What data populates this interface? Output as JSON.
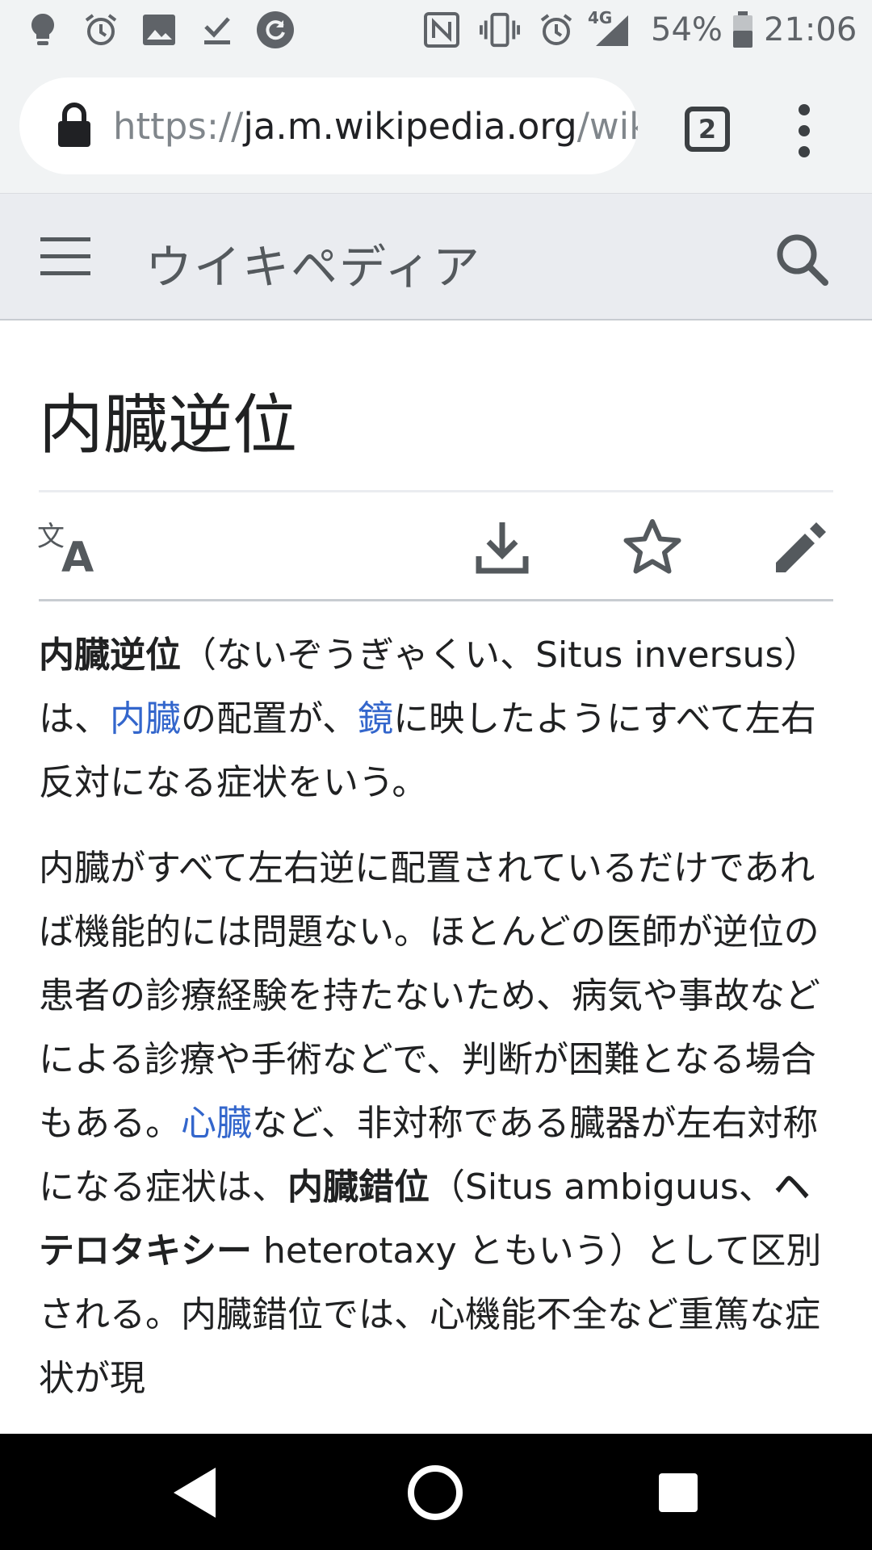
{
  "status_bar": {
    "left_icons": [
      "lightbulb-icon",
      "alarm-icon",
      "image-icon",
      "download-done-icon",
      "sync-icon"
    ],
    "right_icons": [
      "nfc-icon",
      "vibrate-icon",
      "alarm-icon",
      "signal-icon",
      "battery-icon"
    ],
    "network": "4G",
    "battery": "54%",
    "time": "21:06"
  },
  "browser": {
    "url_scheme": "https://",
    "url_host": "ja.m.wikipedia.org",
    "url_path": "/wik",
    "tab_count": "2"
  },
  "wiki_header": {
    "title": "ウイキペディア"
  },
  "page": {
    "title": "内臓逆位",
    "actions": [
      "language-icon",
      "download-icon",
      "star-icon",
      "edit-icon"
    ]
  },
  "article": {
    "p1": {
      "bold": "内臓逆位",
      "t1": "（ないぞうぎゃくい、Situs inversus）は、",
      "link1": "内臓",
      "t2": "の配置が、",
      "link2": "鏡",
      "t3": "に映したようにすべて左右反対になる症状をいう。"
    },
    "p2": {
      "t1": "内臓がすべて左右逆に配置されているだけであれば機能的には問題ない。ほとんどの医師が逆位の患者の診療経験を持たないため、病気や事故などによる診療や手術などで、判断が困難となる場合もある。",
      "link1": "心臓",
      "t2": "など、非対称である臓器が左右対称になる症状は、",
      "bold1": "内臓錯位",
      "t3": "（Situs ambiguus、",
      "bold2": "ヘテロタキシー",
      "t4": " heterotaxy ともいう）として区別される。内臓錯位では、心機能不全など重篤な症状が現"
    }
  },
  "colors": {
    "link": "#3366cc",
    "header_bg": "#eaecf0",
    "chrome_bg": "#f1f3f4",
    "nav_bg": "#000000"
  }
}
